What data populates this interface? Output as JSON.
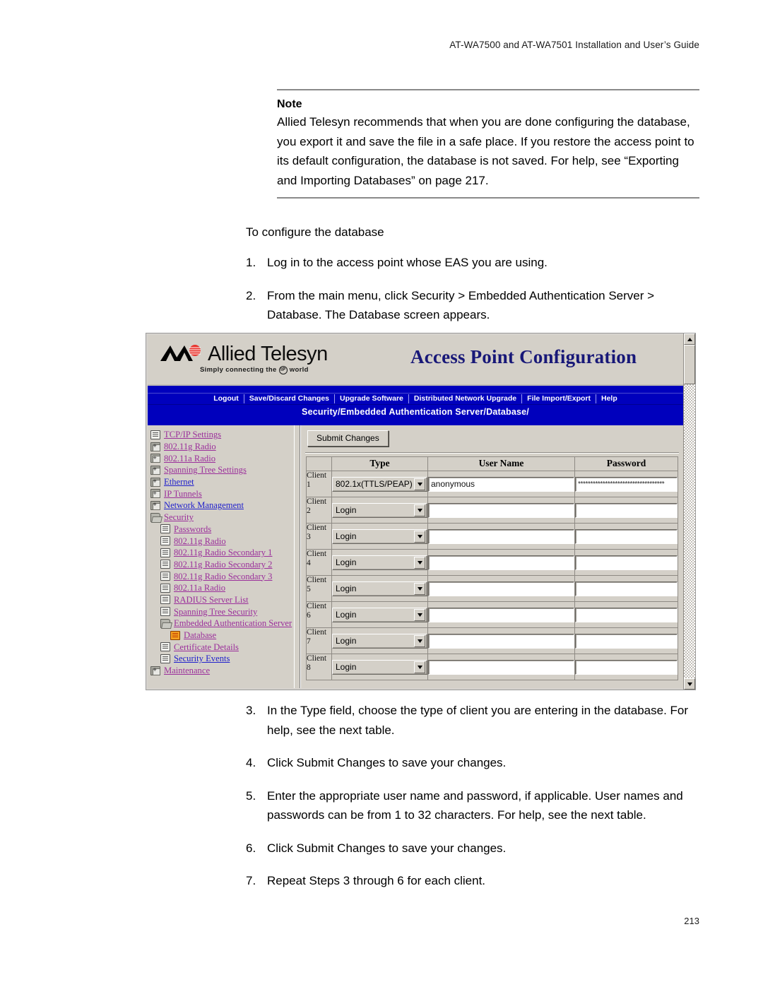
{
  "page": {
    "running_head": "AT-WA7500 and AT-WA7501 Installation and User’s Guide",
    "page_number": "213"
  },
  "note": {
    "title": "Note",
    "body": "Allied Telesyn recommends that when you are done configuring the database, you export it and save the file in a safe place. If you restore the access point to its default configuration, the database is not saved. For help, see “Exporting and Importing Databases” on page 217."
  },
  "procedure": {
    "lead": "To configure the database",
    "steps_top": [
      {
        "num": "1.",
        "text": "Log in to the access point whose EAS you are using."
      },
      {
        "num": "2.",
        "text": "From the main menu, click Security > Embedded Authentication Server > Database. The Database screen appears."
      }
    ],
    "steps_bottom": [
      {
        "num": "3.",
        "text": "In the Type field, choose the type of client you are entering in the database. For help, see the next table."
      },
      {
        "num": "4.",
        "text": "Click Submit Changes to save your changes."
      },
      {
        "num": "5.",
        "text": "Enter the appropriate user name and password, if applicable. User names and passwords can be from 1 to 32 characters. For help, see the next table."
      },
      {
        "num": "6.",
        "text": "Click Submit Changes to save your changes."
      },
      {
        "num": "7.",
        "text": "Repeat Steps 3 through 6 for each client."
      }
    ]
  },
  "screenshot": {
    "brand": {
      "name": "Allied Telesyn",
      "tagline_before": "Simply connecting the",
      "tagline_badge": "IP",
      "tagline_after": "world",
      "logo_icon": "allied-telesyn-logo-icon"
    },
    "app_title": "Access Point Configuration",
    "menu": [
      "Logout",
      "Save/Discard Changes",
      "Upgrade Software",
      "Distributed Network Upgrade",
      "File Import/Export",
      "Help"
    ],
    "breadcrumb": "Security/Embedded Authentication Server/Database/",
    "colors": {
      "menu_band": "#0000bd",
      "title": "#181878",
      "chrome": "#d4d0c8",
      "link": "#9b2f9b",
      "link_visited": "#2020cc",
      "selected_icon": "#f4a020"
    },
    "tree": [
      {
        "label": "TCP/IP Settings",
        "icon": "page-icon",
        "level": 1,
        "link_color": "purple"
      },
      {
        "label": "802.11g Radio",
        "icon": "folder-icon",
        "level": 1,
        "link_color": "purple"
      },
      {
        "label": "802.11a Radio",
        "icon": "folder-icon",
        "level": 1,
        "link_color": "purple"
      },
      {
        "label": "Spanning Tree Settings",
        "icon": "folder-icon",
        "level": 1,
        "link_color": "purple"
      },
      {
        "label": "Ethernet",
        "icon": "folder-icon",
        "level": 1,
        "link_color": "blue"
      },
      {
        "label": "IP Tunnels",
        "icon": "folder-icon",
        "level": 1,
        "link_color": "purple"
      },
      {
        "label": "Network Management",
        "icon": "folder-icon",
        "level": 1,
        "link_color": "blue"
      },
      {
        "label": "Security",
        "icon": "folder-open-icon",
        "level": 1,
        "link_color": "purple"
      },
      {
        "label": "Passwords",
        "icon": "page-icon",
        "level": 2,
        "link_color": "purple"
      },
      {
        "label": "802.11g Radio",
        "icon": "page-icon",
        "level": 2,
        "link_color": "purple"
      },
      {
        "label": "802.11g Radio Secondary 1",
        "icon": "page-icon",
        "level": 2,
        "link_color": "purple"
      },
      {
        "label": "802.11g Radio Secondary 2",
        "icon": "page-icon",
        "level": 2,
        "link_color": "purple"
      },
      {
        "label": "802.11g Radio Secondary 3",
        "icon": "page-icon",
        "level": 2,
        "link_color": "purple"
      },
      {
        "label": "802.11a Radio",
        "icon": "page-icon",
        "level": 2,
        "link_color": "purple"
      },
      {
        "label": "RADIUS Server List",
        "icon": "page-icon",
        "level": 2,
        "link_color": "purple"
      },
      {
        "label": "Spanning Tree Security",
        "icon": "page-icon",
        "level": 2,
        "link_color": "purple"
      },
      {
        "label": "Embedded Authentication Server",
        "icon": "folder-open-icon",
        "level": 2,
        "link_color": "purple"
      },
      {
        "label": "Database",
        "icon": "page-selected-icon",
        "level": 3,
        "link_color": "purple"
      },
      {
        "label": "Certificate Details",
        "icon": "page-icon",
        "level": 2,
        "link_color": "purple"
      },
      {
        "label": "Security Events",
        "icon": "page-icon",
        "level": 2,
        "link_color": "blue"
      },
      {
        "label": "Maintenance",
        "icon": "folder-icon",
        "level": 1,
        "link_color": "purple"
      }
    ],
    "submit_button": "Submit Changes",
    "table": {
      "headers": [
        "",
        "Type",
        "User Name",
        "Password"
      ],
      "rows": [
        {
          "index": "Client 1",
          "type": "802.1x(TTLS/PEAP)",
          "user_name": "anonymous",
          "password": "***********************************"
        },
        {
          "index": "Client 2",
          "type": "Login",
          "user_name": "",
          "password": ""
        },
        {
          "index": "Client 3",
          "type": "Login",
          "user_name": "",
          "password": ""
        },
        {
          "index": "Client 4",
          "type": "Login",
          "user_name": "",
          "password": ""
        },
        {
          "index": "Client 5",
          "type": "Login",
          "user_name": "",
          "password": ""
        },
        {
          "index": "Client 6",
          "type": "Login",
          "user_name": "",
          "password": ""
        },
        {
          "index": "Client 7",
          "type": "Login",
          "user_name": "",
          "password": ""
        },
        {
          "index": "Client 8",
          "type": "Login",
          "user_name": "",
          "password": ""
        }
      ]
    }
  }
}
